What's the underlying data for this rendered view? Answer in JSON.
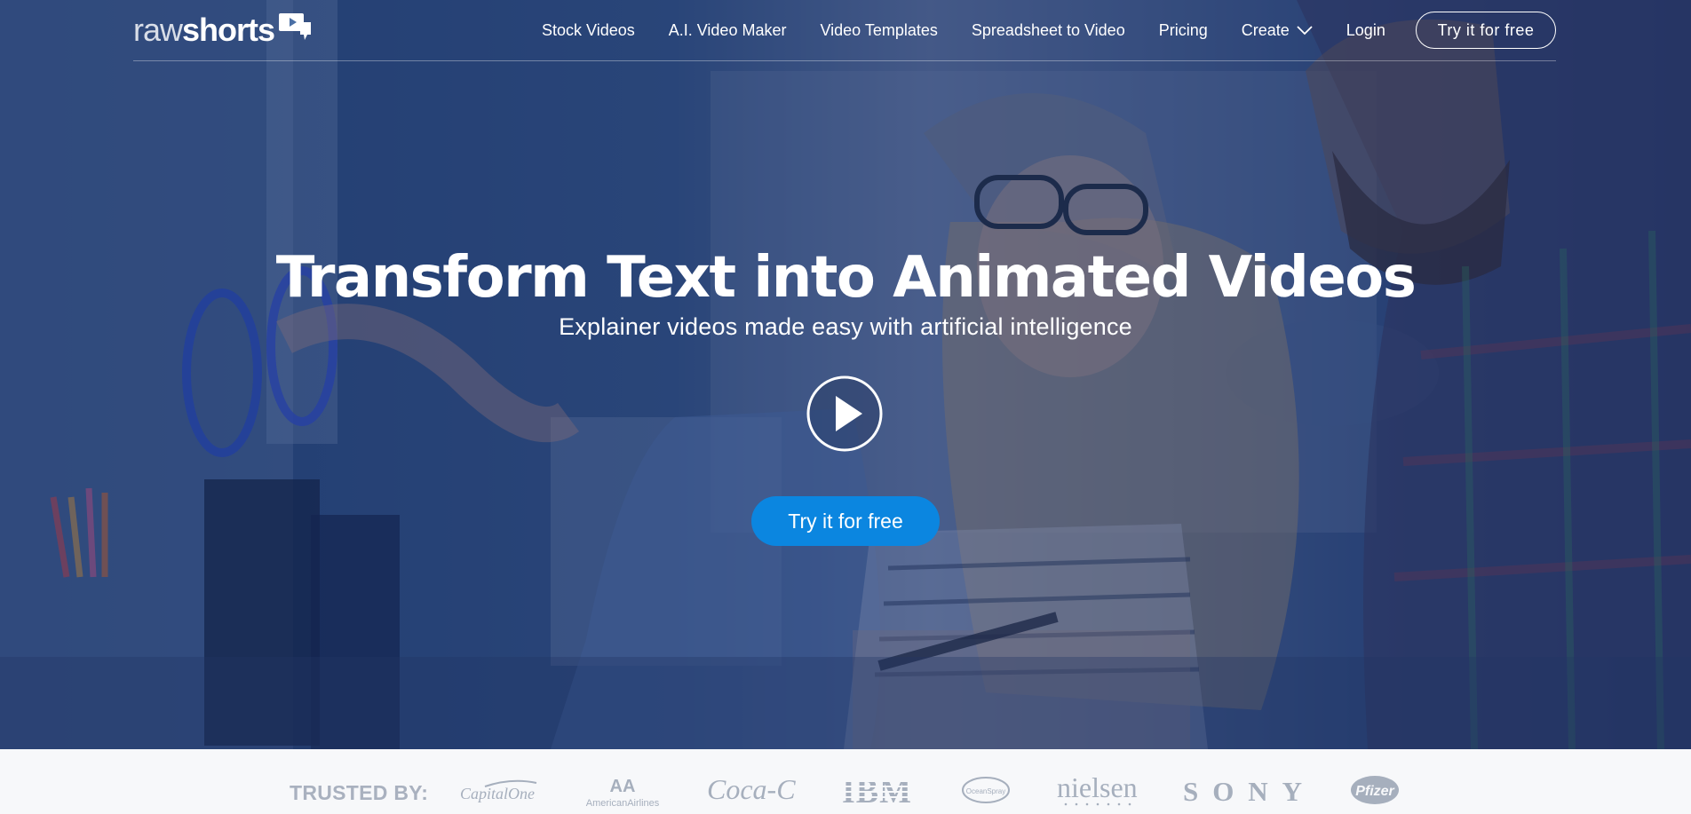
{
  "logo": {
    "part1": "raw",
    "part2": "shorts"
  },
  "nav": {
    "links": [
      "Stock Videos",
      "A.I. Video Maker",
      "Video Templates",
      "Spreadsheet to Video",
      "Pricing"
    ],
    "create_label": "Create",
    "login_label": "Login",
    "cta_label": "Try it for free"
  },
  "hero": {
    "headline": "Transform Text into Animated Videos",
    "subhead": "Explainer videos made easy with artificial intelligence",
    "cta_label": "Try it for free"
  },
  "trusted": {
    "label": "TRUSTED BY:",
    "brands": {
      "capital_one": "CapitalOne",
      "american_airlines": "AmericanAirlines",
      "coca_cola": "Coca-Cola",
      "ibm": "IBM",
      "ocean_spray": "OceanSpray",
      "nielsen": "nielsen",
      "sony": "SONY",
      "pfizer": "Pfizer"
    }
  },
  "colors": {
    "accent": "#0b86e0",
    "overlay": "#162d64",
    "muted_logo": "#a6afbd"
  },
  "icons": {
    "logo": "speech-bubble-play-icon",
    "create": "chevron-down-icon",
    "play": "play-circle-icon"
  }
}
